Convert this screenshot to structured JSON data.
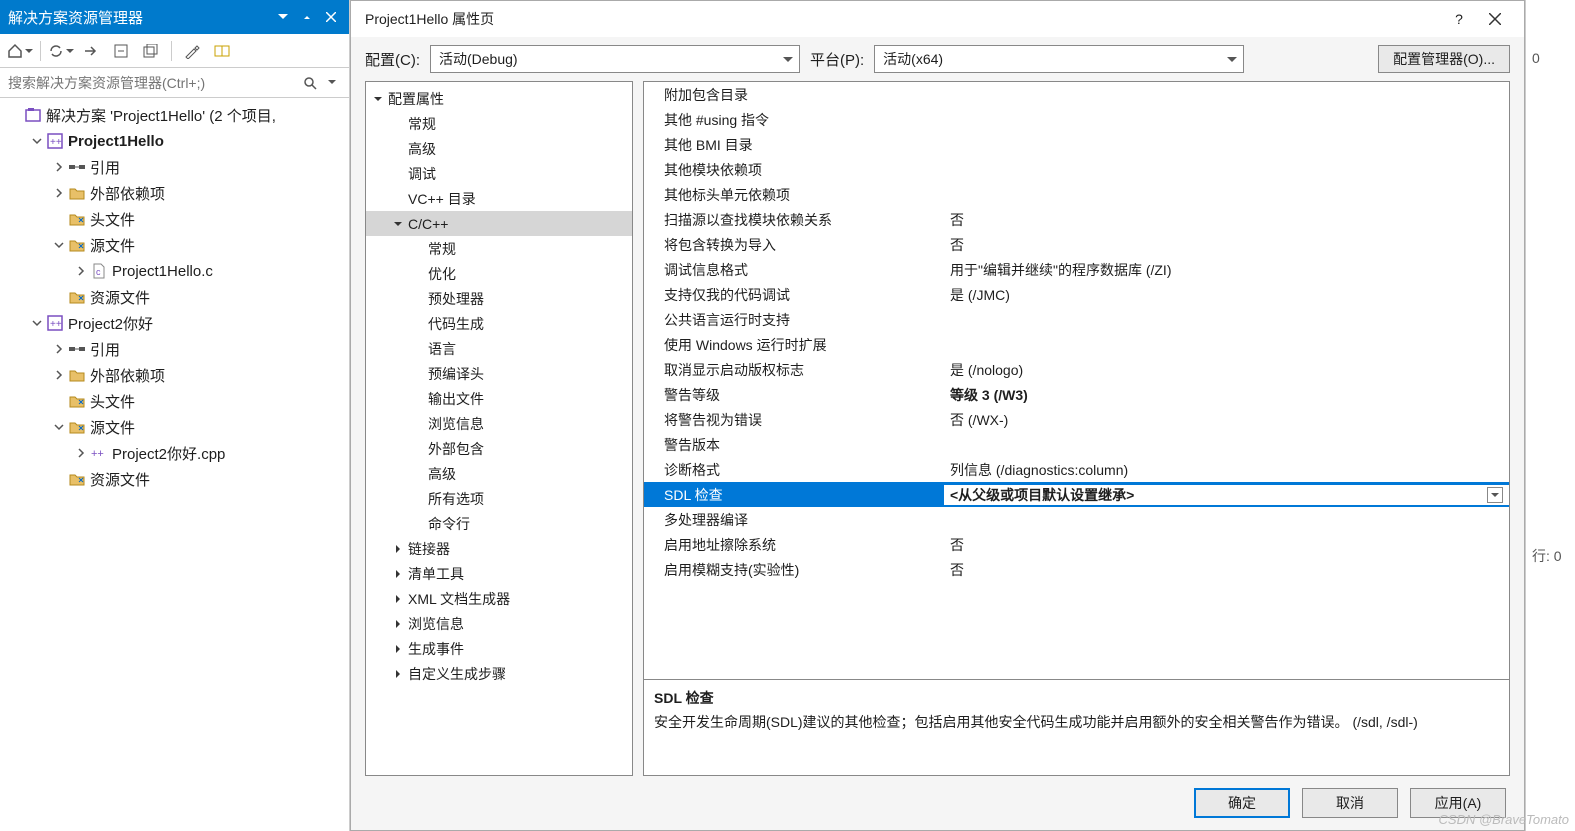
{
  "solution_explorer": {
    "title": "解决方案资源管理器",
    "search_placeholder": "搜索解决方案资源管理器(Ctrl+;)",
    "tree": [
      {
        "depth": 0,
        "twist": "none",
        "icon": "solution",
        "label": "解决方案 'Project1Hello' (2 个项目,",
        "bold": false
      },
      {
        "depth": 1,
        "twist": "open",
        "icon": "project",
        "label": "Project1Hello",
        "bold": true
      },
      {
        "depth": 2,
        "twist": "closed",
        "icon": "ref",
        "label": "引用",
        "bold": false
      },
      {
        "depth": 2,
        "twist": "closed",
        "icon": "folder",
        "label": "外部依赖项",
        "bold": false
      },
      {
        "depth": 2,
        "twist": "none",
        "icon": "filter",
        "label": "头文件",
        "bold": false
      },
      {
        "depth": 2,
        "twist": "open",
        "icon": "filter",
        "label": "源文件",
        "bold": false
      },
      {
        "depth": 3,
        "twist": "closed",
        "icon": "cfile",
        "label": "Project1Hello.c",
        "bold": false
      },
      {
        "depth": 2,
        "twist": "none",
        "icon": "filter",
        "label": "资源文件",
        "bold": false
      },
      {
        "depth": 1,
        "twist": "open",
        "icon": "project",
        "label": "Project2你好",
        "bold": false
      },
      {
        "depth": 2,
        "twist": "closed",
        "icon": "ref",
        "label": "引用",
        "bold": false
      },
      {
        "depth": 2,
        "twist": "closed",
        "icon": "folder",
        "label": "外部依赖项",
        "bold": false
      },
      {
        "depth": 2,
        "twist": "none",
        "icon": "filter",
        "label": "头文件",
        "bold": false
      },
      {
        "depth": 2,
        "twist": "open",
        "icon": "filter",
        "label": "源文件",
        "bold": false
      },
      {
        "depth": 3,
        "twist": "closed",
        "icon": "cpp",
        "label": "Project2你好.cpp",
        "bold": false
      },
      {
        "depth": 2,
        "twist": "none",
        "icon": "filter",
        "label": "资源文件",
        "bold": false
      }
    ]
  },
  "dialog": {
    "title": "Project1Hello 属性页",
    "config_label": "配置(C):",
    "config_value": "活动(Debug)",
    "platform_label": "平台(P):",
    "platform_value": "活动(x64)",
    "config_mgr": "配置管理器(O)...",
    "nav": [
      {
        "depth": 0,
        "twist": "open",
        "label": "配置属性"
      },
      {
        "depth": 1,
        "twist": "none",
        "label": "常规"
      },
      {
        "depth": 1,
        "twist": "none",
        "label": "高级"
      },
      {
        "depth": 1,
        "twist": "none",
        "label": "调试"
      },
      {
        "depth": 1,
        "twist": "none",
        "label": "VC++ 目录"
      },
      {
        "depth": 1,
        "twist": "open",
        "label": "C/C++",
        "hi": true
      },
      {
        "depth": 2,
        "twist": "none",
        "label": "常规"
      },
      {
        "depth": 2,
        "twist": "none",
        "label": "优化"
      },
      {
        "depth": 2,
        "twist": "none",
        "label": "预处理器"
      },
      {
        "depth": 2,
        "twist": "none",
        "label": "代码生成"
      },
      {
        "depth": 2,
        "twist": "none",
        "label": "语言"
      },
      {
        "depth": 2,
        "twist": "none",
        "label": "预编译头"
      },
      {
        "depth": 2,
        "twist": "none",
        "label": "输出文件"
      },
      {
        "depth": 2,
        "twist": "none",
        "label": "浏览信息"
      },
      {
        "depth": 2,
        "twist": "none",
        "label": "外部包含"
      },
      {
        "depth": 2,
        "twist": "none",
        "label": "高级"
      },
      {
        "depth": 2,
        "twist": "none",
        "label": "所有选项"
      },
      {
        "depth": 2,
        "twist": "none",
        "label": "命令行"
      },
      {
        "depth": 1,
        "twist": "closed",
        "label": "链接器"
      },
      {
        "depth": 1,
        "twist": "closed",
        "label": "清单工具"
      },
      {
        "depth": 1,
        "twist": "closed",
        "label": "XML 文档生成器"
      },
      {
        "depth": 1,
        "twist": "closed",
        "label": "浏览信息"
      },
      {
        "depth": 1,
        "twist": "closed",
        "label": "生成事件"
      },
      {
        "depth": 1,
        "twist": "closed",
        "label": "自定义生成步骤"
      }
    ],
    "props": [
      {
        "k": "附加包含目录",
        "v": ""
      },
      {
        "k": "其他 #using 指令",
        "v": ""
      },
      {
        "k": "其他 BMI 目录",
        "v": ""
      },
      {
        "k": "其他模块依赖项",
        "v": ""
      },
      {
        "k": "其他标头单元依赖项",
        "v": ""
      },
      {
        "k": "扫描源以查找模块依赖关系",
        "v": "否"
      },
      {
        "k": "将包含转换为导入",
        "v": "否"
      },
      {
        "k": "调试信息格式",
        "v": "用于\"编辑并继续\"的程序数据库 (/ZI)"
      },
      {
        "k": "支持仅我的代码调试",
        "v": "是 (/JMC)"
      },
      {
        "k": "公共语言运行时支持",
        "v": ""
      },
      {
        "k": "使用 Windows 运行时扩展",
        "v": ""
      },
      {
        "k": "取消显示启动版权标志",
        "v": "是 (/nologo)"
      },
      {
        "k": "警告等级",
        "v": "等级 3 (/W3)",
        "vbold": true
      },
      {
        "k": "将警告视为错误",
        "v": "否 (/WX-)"
      },
      {
        "k": "警告版本",
        "v": ""
      },
      {
        "k": "诊断格式",
        "v": "列信息 (/diagnostics:column)"
      },
      {
        "k": "SDL 检查",
        "v": "<从父级或项目默认设置继承>",
        "sel": true,
        "dd": true
      },
      {
        "k": "多处理器编译",
        "v": ""
      },
      {
        "k": "启用地址擦除系统",
        "v": "否"
      },
      {
        "k": "启用模糊支持(实验性)",
        "v": "否"
      }
    ],
    "desc_title": "SDL 检查",
    "desc_body": "安全开发生命周期(SDL)建议的其他检查；包括启用其他安全代码生成功能并启用额外的安全相关警告作为错误。     (/sdl, /sdl-)",
    "ok": "确定",
    "cancel": "取消",
    "apply": "应用(A)"
  },
  "sliver": {
    "top": "0",
    "bottom": "行: 0"
  },
  "watermark": "CSDN @BraveTomato"
}
